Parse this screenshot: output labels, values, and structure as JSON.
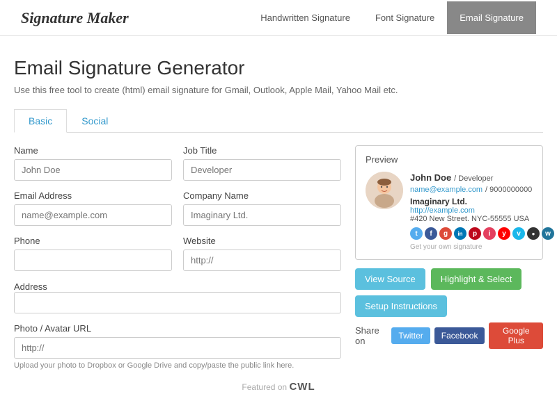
{
  "header": {
    "logo": "Signature Maker",
    "nav": [
      {
        "label": "Handwritten Signature",
        "active": false
      },
      {
        "label": "Font Signature",
        "active": false
      },
      {
        "label": "Email Signature",
        "active": true
      }
    ]
  },
  "page": {
    "title": "Email Signature Generator",
    "subtitle": "Use this free tool to create (html) email signature for Gmail, Outlook, Apple Mail, Yahoo Mail etc."
  },
  "tabs": [
    {
      "label": "Basic",
      "active": true
    },
    {
      "label": "Social",
      "active": false
    }
  ],
  "form": {
    "name_label": "Name",
    "name_placeholder": "John Doe",
    "jobtitle_label": "Job Title",
    "jobtitle_placeholder": "Developer",
    "email_label": "Email Address",
    "email_placeholder": "name@example.com",
    "company_label": "Company Name",
    "company_placeholder": "Imaginary Ltd.",
    "phone_label": "Phone",
    "phone_placeholder": "",
    "website_label": "Website",
    "website_placeholder": "http://",
    "address_label": "Address",
    "address_placeholder": "",
    "photo_label": "Photo / Avatar URL",
    "photo_placeholder": "http://",
    "photo_note": "Upload your photo to Dropbox or Google Drive and copy/paste the public link here."
  },
  "preview": {
    "header": "Preview",
    "name": "John Doe",
    "jobtitle": "Developer",
    "email": "name@example.com",
    "phone": "9000000000",
    "company": "Imaginary Ltd.",
    "website": "http://example.com",
    "address": "#420 New Street. NYC-55555 USA",
    "watermark": "Get your own signature",
    "buttons": {
      "view_source": "View Source",
      "highlight": "Highlight & Select",
      "setup": "Setup Instructions"
    }
  },
  "share": {
    "label": "Share on",
    "twitter": "Twitter",
    "facebook": "Facebook",
    "google_plus": "Google Plus"
  },
  "footer": {
    "text": "Featured on",
    "brand": "CWL"
  },
  "social_icons": [
    {
      "name": "twitter",
      "class": "si-twitter",
      "letter": "t"
    },
    {
      "name": "facebook",
      "class": "si-facebook",
      "letter": "f"
    },
    {
      "name": "google",
      "class": "si-google",
      "letter": "g"
    },
    {
      "name": "linkedin",
      "class": "si-linkedin",
      "letter": "in"
    },
    {
      "name": "pinterest",
      "class": "si-pinterest",
      "letter": "p"
    },
    {
      "name": "instagram",
      "class": "si-instagram",
      "letter": "i"
    },
    {
      "name": "youtube",
      "class": "si-youtube",
      "letter": "y"
    },
    {
      "name": "vimeo",
      "class": "si-vimeo",
      "letter": "v"
    },
    {
      "name": "black",
      "class": "si-black",
      "letter": "●"
    },
    {
      "name": "wordpress",
      "class": "si-wordpress",
      "letter": "w"
    }
  ]
}
